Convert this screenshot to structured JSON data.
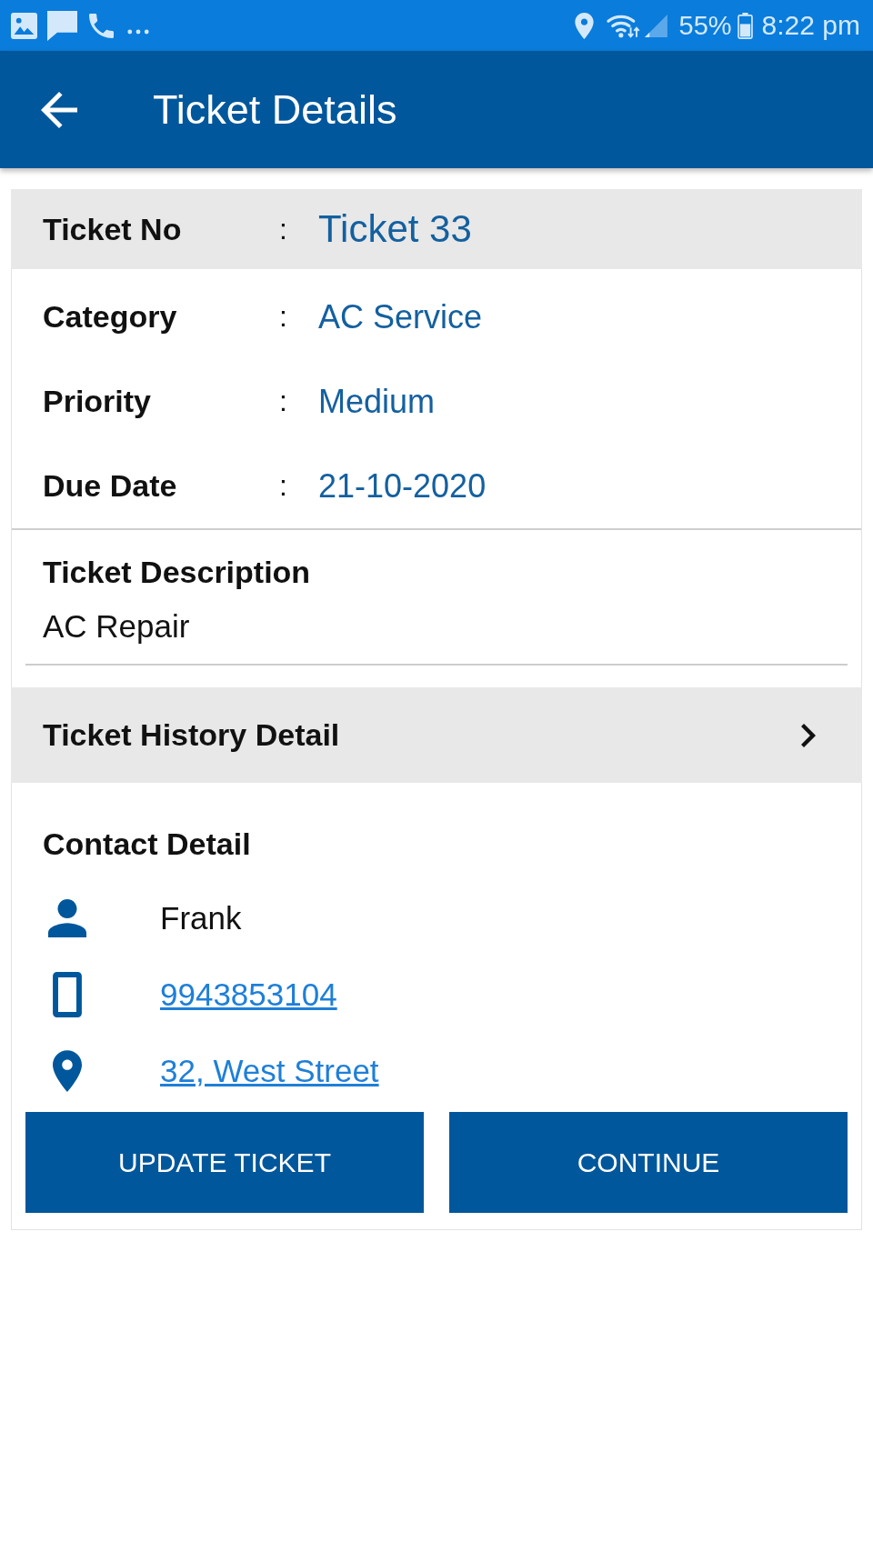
{
  "status_bar": {
    "battery_text": "55%",
    "time": "8:22 pm"
  },
  "app_bar": {
    "title": "Ticket Details"
  },
  "ticket_header": {
    "label": "Ticket No",
    "separator": ":",
    "value": "Ticket 33"
  },
  "fields": [
    {
      "label": "Category",
      "separator": ":",
      "value": "AC Service"
    },
    {
      "label": "Priority",
      "separator": ":",
      "value": "Medium"
    },
    {
      "label": "Due Date",
      "separator": ":",
      "value": "21-10-2020"
    }
  ],
  "description": {
    "title": "Ticket Description",
    "text": "AC Repair"
  },
  "history": {
    "label": "Ticket History Detail"
  },
  "contact": {
    "title": "Contact Detail",
    "items": [
      {
        "kind": "person",
        "text": "Frank"
      },
      {
        "kind": "phone",
        "text": "9943853104"
      },
      {
        "kind": "address",
        "text": "32, West Street"
      }
    ]
  },
  "buttons": [
    {
      "label": "UPDATE TICKET"
    },
    {
      "label": "CONTINUE"
    }
  ]
}
